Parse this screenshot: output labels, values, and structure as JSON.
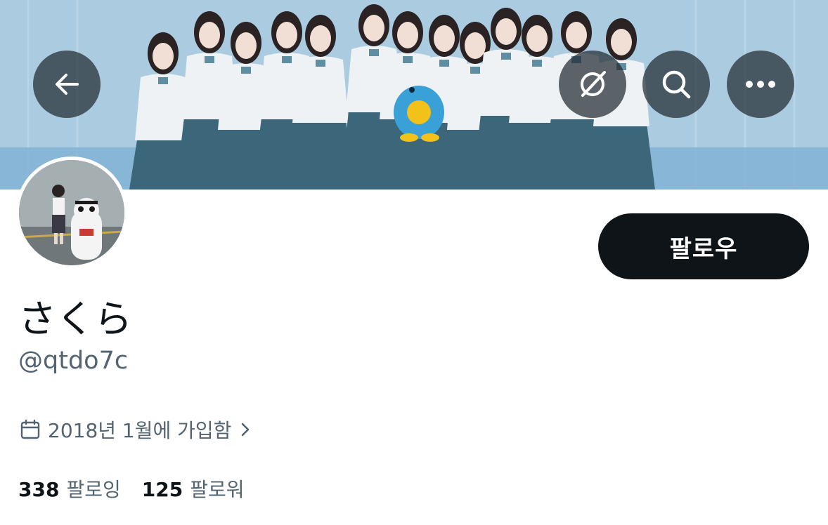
{
  "header": {
    "back_icon": "arrow-left-icon",
    "grok_icon": "slash-circle-icon",
    "search_icon": "search-icon",
    "more_icon": "more-horizontal-icon"
  },
  "profile": {
    "display_name": "さくら",
    "handle": "@qtdo7c",
    "joined": "2018년 1월에 가입함",
    "follow_label": "팔로우"
  },
  "stats": {
    "following_count": "338",
    "following_label": "팔로잉",
    "followers_count": "125",
    "followers_label": "팔로워"
  },
  "colors": {
    "text_primary": "#0f1419",
    "text_secondary": "#536471",
    "follow_button_bg": "#0f1419",
    "overlay_button_bg": "rgba(30,38,44,0.70)"
  }
}
